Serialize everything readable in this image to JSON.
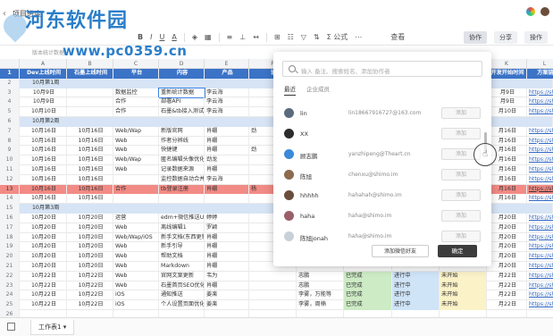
{
  "title": "项目进度",
  "watermark": {
    "logo": "河东软件园",
    "url": "www.pc0359.cn"
  },
  "toolbar": {
    "font_btn": "A",
    "formula_label": "公式",
    "view_label": "查看",
    "collab_label": "协作",
    "share_label": "分享",
    "ops_label": "操作"
  },
  "formula_text": "版本统计数据",
  "columns": [
    "A",
    "B",
    "C",
    "D",
    "E",
    "F",
    "G",
    "H",
    "I",
    "J",
    "K",
    "L"
  ],
  "header_cells": [
    "Dev上线时间",
    "石墨上线时间",
    "平台",
    "内容",
    "产品",
    "设",
    "",
    "",
    "",
    "",
    "开发开始时间",
    "方案链"
  ],
  "rows": [
    {
      "n": "1",
      "type": "header"
    },
    {
      "n": "2",
      "type": "group",
      "label": "10月第1周"
    },
    {
      "n": "3",
      "cells": [
        "10月9日",
        "",
        "数据监控",
        "重新统计数据",
        "李云海",
        "",
        "",
        "",
        "",
        "",
        "月9日",
        "https://sh"
      ]
    },
    {
      "n": "4",
      "cells": [
        "10月9日",
        "",
        "合作",
        "部署API",
        "李云海",
        "",
        "",
        "",
        "",
        "",
        "月9日",
        "https://sh"
      ]
    },
    {
      "n": "5",
      "cells": [
        "10月10日",
        "",
        "合作",
        "石墨&tb接入测试",
        "李云海",
        "",
        "",
        "",
        "",
        "",
        "月10日",
        "https://sh"
      ]
    },
    {
      "n": "6",
      "type": "group",
      "label": "10月第2周"
    },
    {
      "n": "7",
      "cells": [
        "10月16日",
        "10月16日",
        "Web/Wap",
        "新版官网",
        "肖硼",
        "劲",
        "",
        "",
        "",
        "",
        "月16日",
        "https://sh"
      ]
    },
    {
      "n": "8",
      "cells": [
        "10月16日",
        "10月16日",
        "Web",
        "作者分辨线",
        "肖硼",
        "",
        "",
        "",
        "",
        "",
        "月16日",
        "https://sh"
      ]
    },
    {
      "n": "9",
      "cells": [
        "10月16日",
        "10月16日",
        "Web",
        "快捷键",
        "肖硼",
        "劲",
        "",
        "",
        "",
        "",
        "月16日",
        "https://sh"
      ]
    },
    {
      "n": "10",
      "cells": [
        "10月16日",
        "10月16日",
        "Web/Wap",
        "匿名编辑头像优化",
        "劲龙",
        "",
        "",
        "",
        "",
        "",
        "月16日",
        "https://sh"
      ]
    },
    {
      "n": "11",
      "cells": [
        "10月16日",
        "10月16日",
        "Web",
        "记录数据来源",
        "肖硼",
        "",
        "",
        "",
        "",
        "",
        "月16日",
        "https://sh"
      ]
    },
    {
      "n": "12",
      "cells": [
        "10月16日",
        "10月16日",
        "",
        "监控数据自动合并",
        "李云海",
        "",
        "",
        "",
        "",
        "",
        "月16日",
        "https://sh"
      ]
    },
    {
      "n": "13",
      "type": "highlight",
      "cells": [
        "10月16日",
        "10月16日",
        "合作",
        "tb登录注册",
        "肖硼",
        "杨",
        "",
        "",
        "",
        "",
        "月16日",
        "https://sh"
      ]
    },
    {
      "n": "14",
      "cells": [
        "10月16日",
        "10月16日",
        "",
        "",
        "",
        "",
        "",
        "",
        "",
        "",
        "月16日",
        "https://sh"
      ]
    },
    {
      "n": "15",
      "type": "group",
      "label": "10月第3周"
    },
    {
      "n": "16",
      "cells": [
        "10月20日",
        "10月20日",
        "运营",
        "edm+微信推送U",
        "婷婷",
        "",
        "",
        "",
        "",
        "",
        "月20日",
        "https://sh"
      ]
    },
    {
      "n": "17",
      "cells": [
        "10月20日",
        "10月20日",
        "Web",
        "离线编辑1",
        "罗颖",
        "",
        "",
        "",
        "",
        "",
        "月20日",
        "https://sh"
      ]
    },
    {
      "n": "18",
      "cells": [
        "10月20日",
        "10月20日",
        "Web/Wap/iOS",
        "新手文档(东西更新)",
        "肖硼",
        "",
        "",
        "",
        "",
        "",
        "月20日",
        "https://sh"
      ]
    },
    {
      "n": "19",
      "cells": [
        "10月20日",
        "10月20日",
        "Web",
        "新手引导",
        "肖硼",
        "",
        "",
        "",
        "",
        "",
        "月20日",
        "https://sh"
      ]
    },
    {
      "n": "20",
      "cells": [
        "10月20日",
        "10月20日",
        "Web",
        "帮助文档",
        "肖硼",
        "",
        "",
        "",
        "",
        "",
        "月20日",
        "https://sh"
      ]
    },
    {
      "n": "21",
      "cells": [
        "10月20日",
        "10月20日",
        "Web",
        "Markdown",
        "肖硼",
        "",
        "",
        "",
        "",
        "",
        "月20日",
        "https://sh"
      ]
    },
    {
      "n": "22",
      "cells": [
        "10月22日",
        "10月22日",
        "Web",
        "官网文案更新",
        "韦为",
        "",
        "志鹏",
        "已完成",
        "进行中",
        "未开始",
        "月22日",
        "https://sh"
      ]
    },
    {
      "n": "23",
      "cells": [
        "10月22日",
        "10月22日",
        "Web",
        "石墨首页SEO优化",
        "肖硼",
        "",
        "志鹏",
        "已完成",
        "进行中",
        "未开始",
        "月22日",
        "https://sh"
      ]
    },
    {
      "n": "24",
      "cells": [
        "10月22日",
        "10月22日",
        "iOS",
        "通知推送",
        "姜楽",
        "",
        "李雾，万能等",
        "已完成",
        "进行中",
        "未开始",
        "月22日",
        "https://sh"
      ]
    },
    {
      "n": "25",
      "cells": [
        "10月22日",
        "10月22日",
        "iOS",
        "个人设置页面优化",
        "姜楽",
        "",
        "李雾，周楠",
        "已完成",
        "进行中",
        "未开始",
        "月22日",
        "https://sh"
      ]
    },
    {
      "n": "26",
      "cells": [
        "",
        "",
        "",
        "",
        "",
        "",
        "",
        "",
        "",
        "",
        "",
        ""
      ]
    }
  ],
  "sheet_tab": "工作表1",
  "popup": {
    "search_placeholder": "输入 备注、搜索姓名、添加协作者",
    "tab_recent": "最近",
    "tab_company": "企业成员",
    "people": [
      {
        "name": "lin",
        "email": "lin18667916727@163.com",
        "add": "添加",
        "color": "#5a6b7e"
      },
      {
        "name": "XX",
        "email": "",
        "add": "添加",
        "color": "#2d2d2d"
      },
      {
        "name": "顾志鹏",
        "email": "yanzhipeng@Theart.cn",
        "add": "添加",
        "color": "#3b8ad9"
      },
      {
        "name": "陈旭",
        "email": "chenxu@shimo.im",
        "add": "添加",
        "color": "#8c6b4f"
      },
      {
        "name": "hhhhh",
        "email": "hahahah@shimo.im",
        "add": "添加",
        "color": "#6a4e3c"
      },
      {
        "name": "haha",
        "email": "haha@shimo.im",
        "add": "添加",
        "color": "#9b5f6a"
      },
      {
        "name": "陈旭jonah",
        "email": "haha@shimo.im",
        "add": "添加",
        "color": "#c8d0d8"
      }
    ],
    "wechat_button": "添加微信好友",
    "ok_button": "确定"
  }
}
